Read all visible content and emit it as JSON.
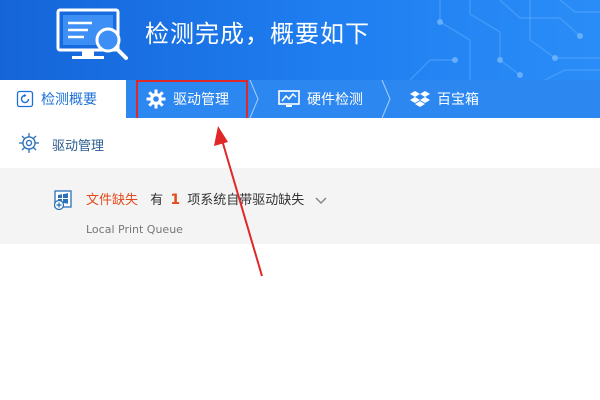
{
  "header": {
    "title": "检测完成，概要如下",
    "icon": "monitor-search-icon"
  },
  "tabs": [
    {
      "label": "检测概要",
      "icon": "refresh-icon"
    },
    {
      "label": "驱动管理",
      "icon": "gear-icon"
    },
    {
      "label": "硬件检测",
      "icon": "chart-monitor-icon"
    },
    {
      "label": "百宝箱",
      "icon": "dropbox-icon"
    }
  ],
  "section": {
    "label": "驱动管理",
    "icon": "gear-icon"
  },
  "missing": {
    "status": "文件缺失",
    "prefix": "有",
    "count": "1",
    "suffix": "项系统自带驱动缺失",
    "driver_name": "Local Print Queue"
  },
  "colors": {
    "header_blue": "#1f7ef0",
    "tab_blue": "#2c87f0",
    "highlight_red": "#e02828",
    "warning_orange": "#e24b1b"
  }
}
